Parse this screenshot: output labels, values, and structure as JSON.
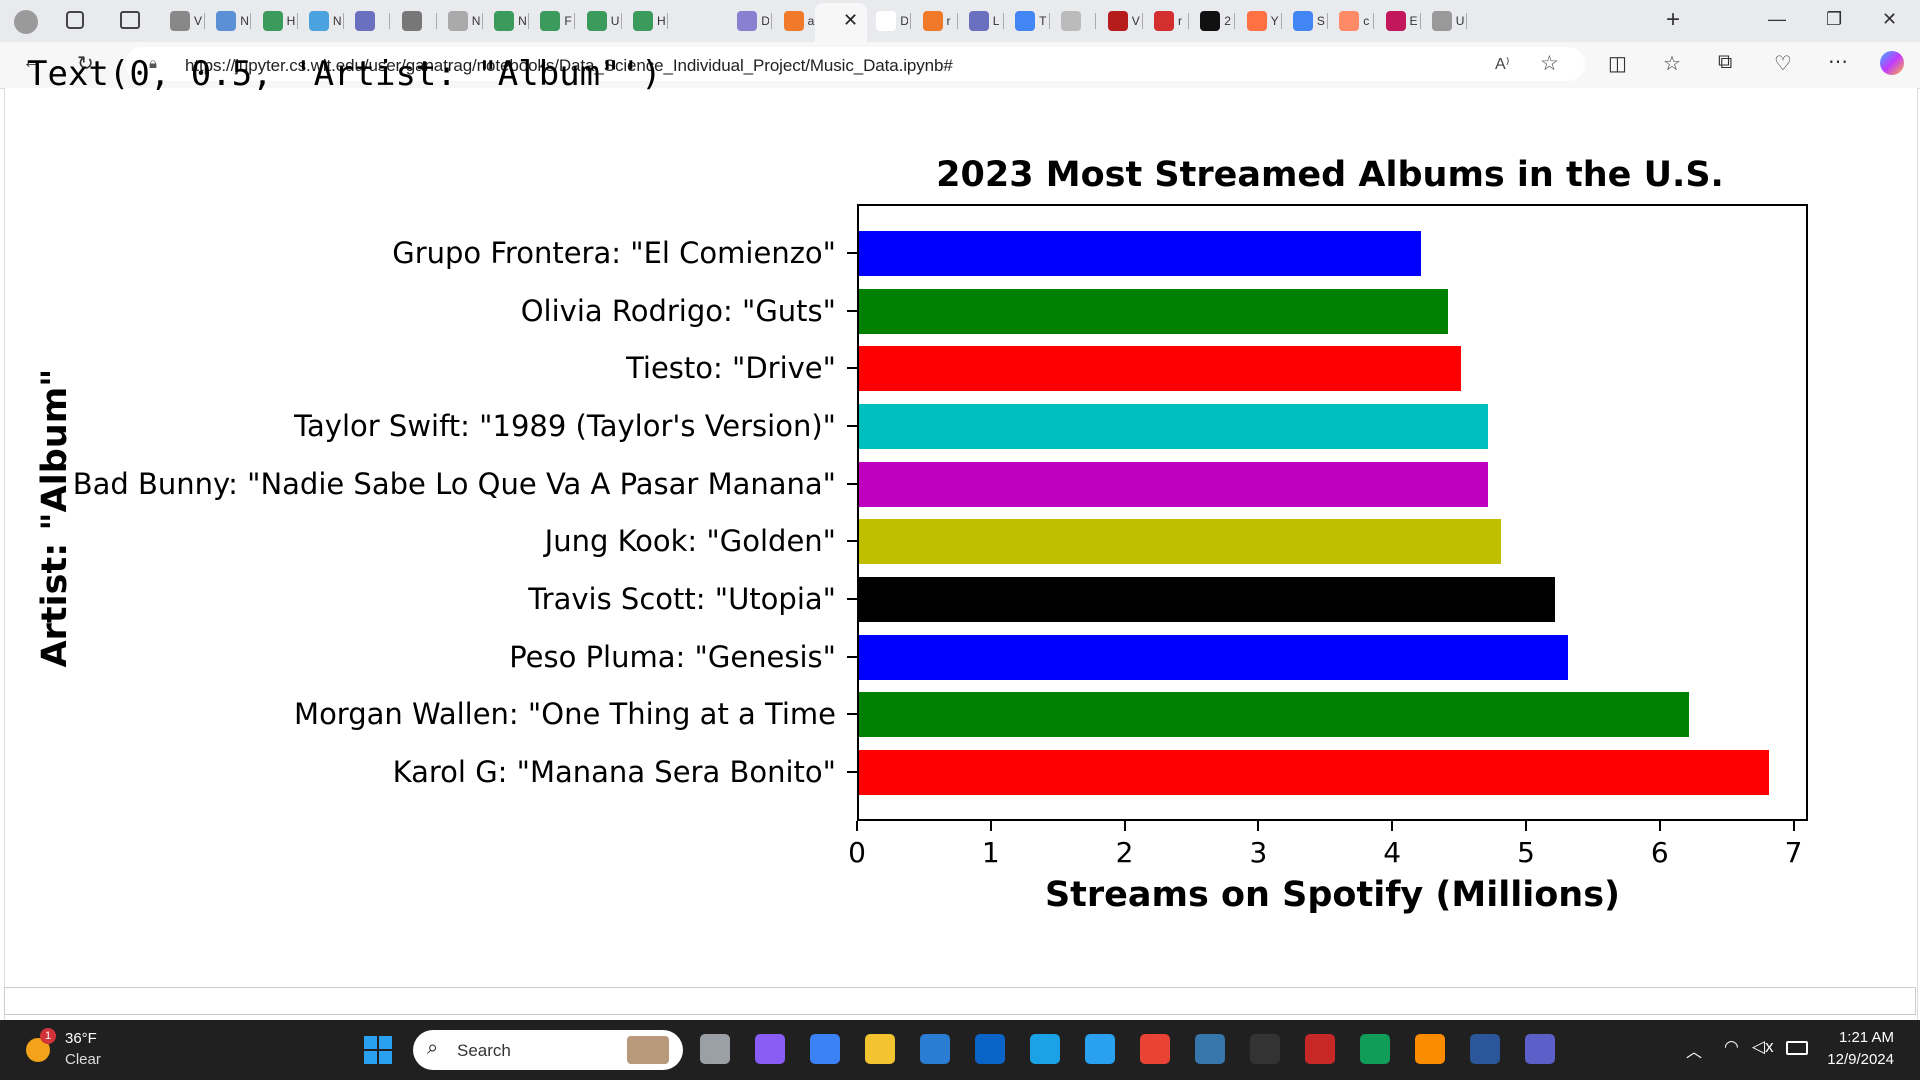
{
  "browser": {
    "url": "https://jupyter.cs.wit.edu/user/ganatrag/notebooks/Data_Science_Individual_Project/Music_Data.ipynb#",
    "tab_labels": [
      "V",
      "N",
      "H",
      "N",
      "",
      "",
      "N",
      "N",
      "F",
      "U",
      "H",
      "D",
      "a",
      "D",
      "D",
      "r",
      "L",
      "T",
      "",
      "V",
      "r",
      "2",
      "Y",
      "S",
      "c",
      "E",
      "U"
    ]
  },
  "notebook": {
    "cell_output_text": "Text(0, 0.5, 'Artist: \"Album\"')"
  },
  "chart_data": {
    "type": "bar",
    "orientation": "horizontal",
    "title": "2023 Most Streamed Albums in the U.S.",
    "xlabel": "Streams on Spotify (Millions)",
    "ylabel": "Artist: \"Album\"",
    "xlim": [
      0,
      7.1
    ],
    "xticks": [
      "0",
      "1",
      "2",
      "3",
      "4",
      "5",
      "6",
      "7"
    ],
    "grid": false,
    "categories": [
      "Grupo Frontera: \"El Comienzo\"",
      "Olivia Rodrigo: \"Guts\"",
      "Tiesto: \"Drive\"",
      "Taylor Swift: \"1989 (Taylor's Version)\"",
      "Bad Bunny: \"Nadie Sabe Lo Que Va A Pasar Manana\"",
      "Jung Kook: \"Golden\"",
      "Travis Scott: \"Utopia\"",
      "Peso Pluma: \"Genesis\"",
      "Morgan Wallen: \"One Thing at a Time",
      "Karol G: \"Manana Sera Bonito\""
    ],
    "values": [
      4.2,
      4.4,
      4.5,
      4.7,
      4.7,
      4.8,
      5.2,
      5.3,
      6.2,
      6.8
    ],
    "colors": [
      "#0000ff",
      "#008000",
      "#ff0000",
      "#00bfbf",
      "#bf00bf",
      "#bfbf00",
      "#000000",
      "#0000ff",
      "#008000",
      "#ff0000"
    ]
  },
  "taskbar": {
    "weather_temp": "36°F",
    "weather_condition": "Clear",
    "weather_badge": "1",
    "search_label": "Search",
    "time": "1:21 AM",
    "date": "12/9/2024"
  }
}
